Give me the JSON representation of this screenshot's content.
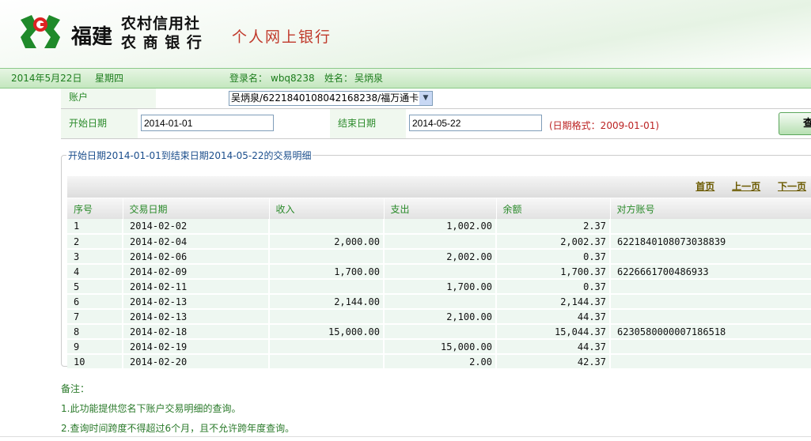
{
  "header": {
    "bank_name_1": "福建",
    "bank_name_2a": "农村信用社",
    "bank_name_2b": "农 商 银 行",
    "service": "个人网上银行"
  },
  "status": {
    "date": "2014年5月22日",
    "weekday": "星期四",
    "login_label": "登录名：",
    "login": "wbq8238",
    "name_label": "姓名：",
    "name": "吴炳泉"
  },
  "form": {
    "account_label": "账户",
    "account_value": "吴炳泉/6221840108042168238/福万通卡",
    "start_label": "开始日期",
    "start_value": "2014-01-01",
    "end_label": "结束日期",
    "end_value": "2014-05-22",
    "hint": "(日期格式：2009-01-01)",
    "query_label": "查"
  },
  "result": {
    "legend": "开始日期2014-01-01到结束日期2014-05-22的交易明细",
    "pager": {
      "first": "首页",
      "prev": "上一页",
      "next": "下一页"
    },
    "columns": [
      "序号",
      "交易日期",
      "收入",
      "支出",
      "余额",
      "对方账号"
    ],
    "rows": [
      [
        "1",
        "2014-02-02",
        "",
        "1,002.00",
        "2.37",
        ""
      ],
      [
        "2",
        "2014-02-04",
        "2,000.00",
        "",
        "2,002.37",
        "6221840108073038839"
      ],
      [
        "3",
        "2014-02-06",
        "",
        "2,002.00",
        "0.37",
        ""
      ],
      [
        "4",
        "2014-02-09",
        "1,700.00",
        "",
        "1,700.37",
        "6226661700486933"
      ],
      [
        "5",
        "2014-02-11",
        "",
        "1,700.00",
        "0.37",
        ""
      ],
      [
        "6",
        "2014-02-13",
        "2,144.00",
        "",
        "2,144.37",
        ""
      ],
      [
        "7",
        "2014-02-13",
        "",
        "2,100.00",
        "44.37",
        ""
      ],
      [
        "8",
        "2014-02-18",
        "15,000.00",
        "",
        "15,044.37",
        "6230580000007186518"
      ],
      [
        "9",
        "2014-02-19",
        "",
        "15,000.00",
        "44.37",
        ""
      ],
      [
        "10",
        "2014-02-20",
        "",
        "2.00",
        "42.37",
        ""
      ]
    ]
  },
  "notes": {
    "title": "备注：",
    "items": [
      "1.此功能提供您名下账户交易明细的查询。",
      "2.查询时间跨度不得超过6个月，且不允许跨年度查询。"
    ]
  }
}
